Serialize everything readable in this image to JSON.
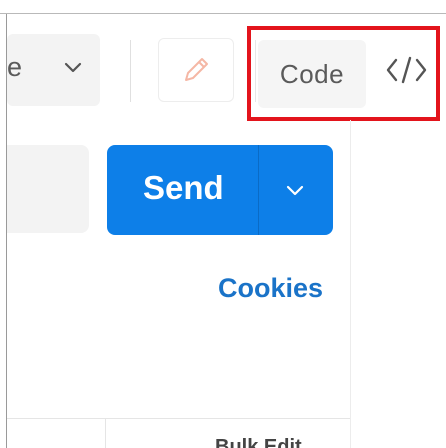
{
  "toolbar": {
    "method_text_fragment": "e",
    "code_label": "Code",
    "code_icon": "code-brackets-icon",
    "edit_icon": "pencil-icon"
  },
  "request": {
    "send_label": "Send",
    "send_dropdown_icon": "chevron-down-icon",
    "cookies_label": "Cookies",
    "bulk_edit_label": "Bulk Edit"
  },
  "colors": {
    "send_blue": "#0d7fe8",
    "link_blue": "#1a73c8",
    "highlight_red": "#e3141c",
    "pencil_orange": "#f5b7a5"
  }
}
